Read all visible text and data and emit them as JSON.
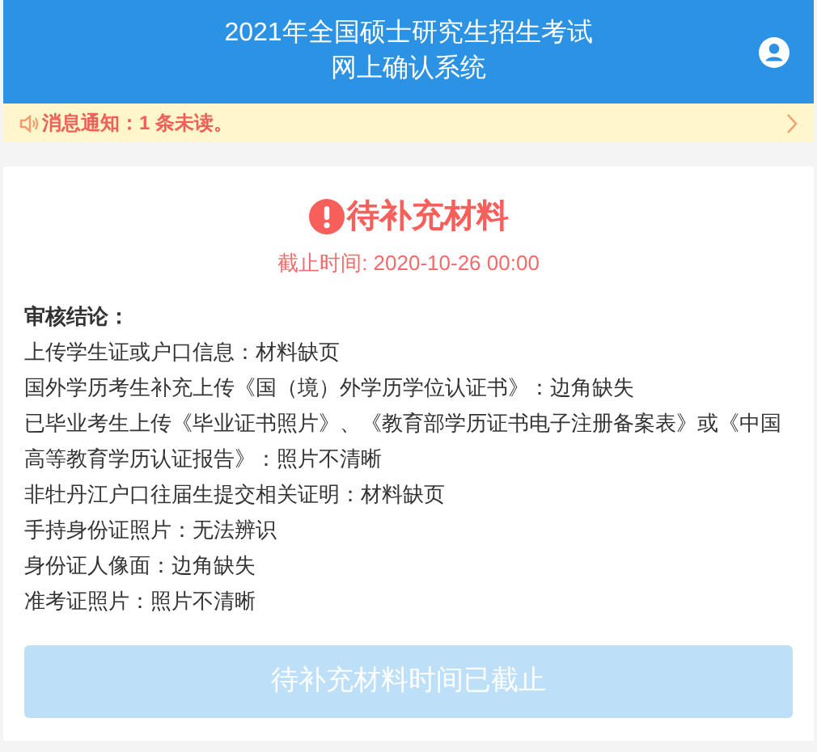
{
  "header": {
    "title": "2021年全国硕士研究生招生考试",
    "subtitle": "网上确认系统"
  },
  "notice": {
    "text": "消息通知：1 条未读。"
  },
  "status": {
    "title": "待补充材料",
    "deadline": "截止时间: 2020-10-26 00:00"
  },
  "review": {
    "heading": "审核结论：",
    "items": [
      "上传学生证或户口信息：材料缺页",
      "国外学历考生补充上传《国（境）外学历学位认证书》：边角缺失",
      "已毕业考生上传《毕业证书照片》、《教育部学历证书电子注册备案表》或《中国高等教育学历认证报告》：照片不清晰",
      "非牡丹江户口往届生提交相关证明：材料缺页",
      "手持身份证照片：无法辨识",
      "身份证人像面：边角缺失",
      "准考证照片：照片不清晰"
    ]
  },
  "action_button": {
    "label": "待补充材料时间已截止",
    "disabled": true
  }
}
